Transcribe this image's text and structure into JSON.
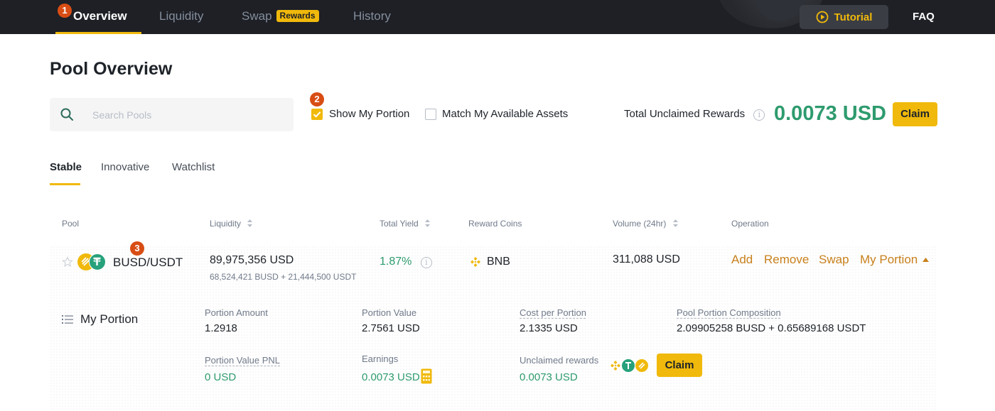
{
  "nav": {
    "items": [
      {
        "label": "Overview",
        "active": true
      },
      {
        "label": "Liquidity",
        "active": false
      },
      {
        "label": "Swap",
        "active": false
      },
      {
        "label": "History",
        "active": false
      }
    ],
    "swap_badge": "Rewards",
    "tutorial_label": "Tutorial",
    "faq_label": "FAQ",
    "markers": [
      "1",
      "2",
      "3"
    ]
  },
  "page": {
    "title": "Pool Overview"
  },
  "filters": {
    "search_placeholder": "Search Pools",
    "show_my_portion": {
      "label": "Show My Portion",
      "checked": true
    },
    "match_assets": {
      "label": "Match My Available Assets",
      "checked": false
    }
  },
  "rewards": {
    "label": "Total Unclaimed Rewards",
    "value": "0.0073 USD",
    "claim_label": "Claim"
  },
  "tabs": [
    {
      "label": "Stable",
      "active": true
    },
    {
      "label": "Innovative",
      "active": false
    },
    {
      "label": "Watchlist",
      "active": false
    }
  ],
  "table": {
    "headers": {
      "pool": "Pool",
      "liquidity": "Liquidity",
      "total_yield": "Total Yield",
      "reward_coins": "Reward Coins",
      "volume": "Volume (24hr)",
      "operation": "Operation"
    },
    "row": {
      "pair": "BUSD/USDT",
      "liquidity": "89,975,356 USD",
      "liquidity_detail": "68,524,421 BUSD + 21,444,500 USDT",
      "total_yield": "1.87%",
      "reward_coin": "BNB",
      "volume": "311,088 USD",
      "operations": [
        "Add",
        "Remove",
        "Swap",
        "My Portion"
      ]
    }
  },
  "portion": {
    "title": "My Portion",
    "portion_amount": {
      "label": "Portion Amount",
      "value": "1.2918"
    },
    "portion_value": {
      "label": "Portion Value",
      "value": "2.7561 USD"
    },
    "cost_per_portion": {
      "label": "Cost per Portion",
      "value": "2.1335 USD"
    },
    "composition": {
      "label": "Pool Portion Composition",
      "value": "2.09905258 BUSD + 0.65689168 USDT"
    },
    "pnl": {
      "label": "Portion Value PNL",
      "value": "0 USD"
    },
    "earnings": {
      "label": "Earnings",
      "value": "0.0073 USD"
    },
    "unclaimed": {
      "label": "Unclaimed rewards",
      "value": "0.0073 USD"
    },
    "claim_label": "Claim"
  },
  "colors": {
    "accent": "#f0b90b",
    "positive": "#2e9b6e",
    "link": "#c8801c",
    "nav_bg": "#1e2026",
    "marker": "#d84d14"
  }
}
